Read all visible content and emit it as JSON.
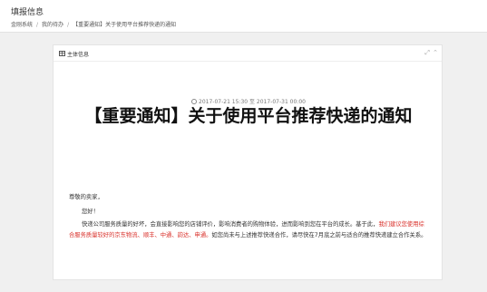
{
  "header": {
    "title": "填报信息",
    "breadcrumb": [
      "金刚系统",
      "我的待办",
      "【重要通知】关于使用平台推荐快递的通知"
    ]
  },
  "panel": {
    "title": "主体信息",
    "date_range": "2017-07-21 15:30 至 2017-07-31 00:00",
    "notice_title": "【重要通知】关于使用平台推荐快递的通知",
    "greeting": "尊敬的卖家，",
    "hello": "您好！",
    "para_part1": "快递公司服务质量的好坏，会直接影响您的店铺评价，影响消费者的购物体验，进而影响到您在平台的成长。基于此，",
    "para_red": "我们建议您使用综合服务质量较好的京东物流、顺丰、中通、韵达、申通。",
    "para_part2": "如您尚未与上述推荐快递合作，请尽快在7月底之前与适合的推荐快递建立合作关系。"
  }
}
